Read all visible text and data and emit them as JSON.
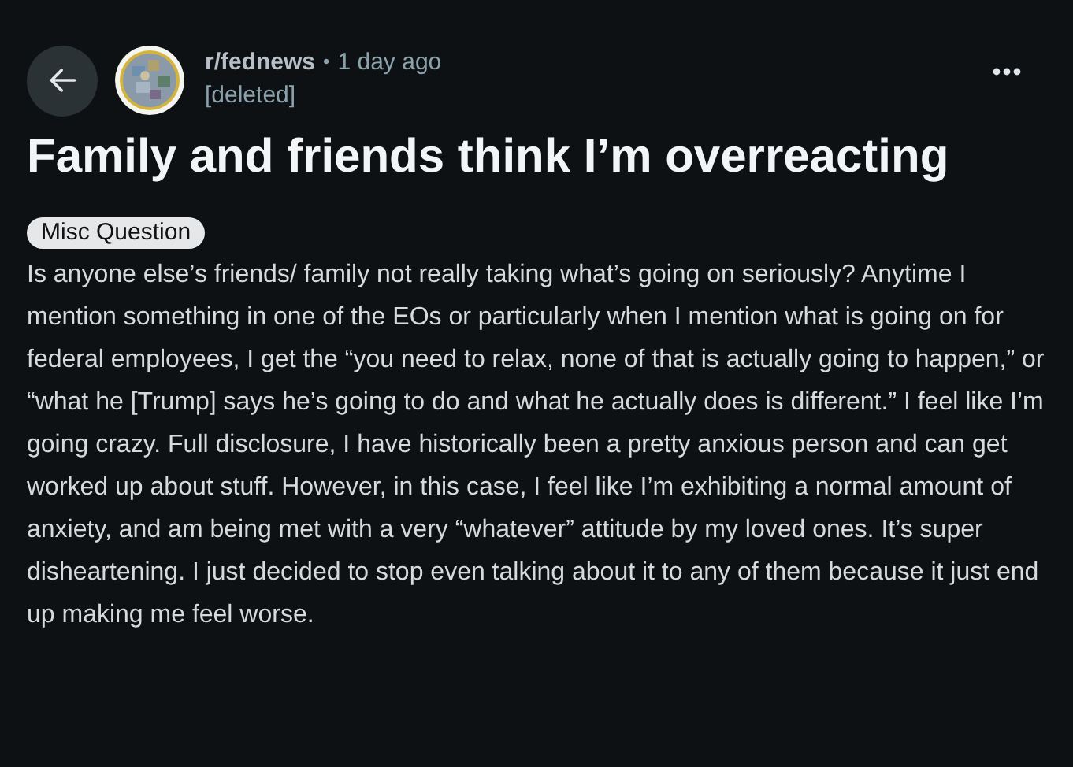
{
  "post": {
    "subreddit": "r/fednews",
    "separator": "•",
    "time": "1 day ago",
    "author": "[deleted]",
    "title": "Family and friends think I’m overreacting",
    "flair": "Misc Question",
    "body": "Is anyone else’s friends/ family not really taking what’s going on seriously? Anytime I mention something in one of the EOs or particularly when I mention what is going on for federal employees, I get the “you need to relax, none of that is actually going to happen,” or “what he [Trump] says he’s going to do and what he actually does is different.” I feel like I’m going crazy. Full disclosure, I have historically been a pretty anxious person and can get worked up about stuff. However, in this case, I feel like I’m exhibiting a normal amount of anxiety, and am being met with a very “whatever” attitude by my loved ones. It’s super disheartening. I just decided to stop even talking about it to any of them because it just end up making me feel worse."
  }
}
